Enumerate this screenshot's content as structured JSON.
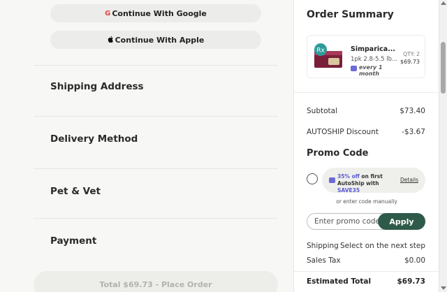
{
  "social": {
    "google_label": "Continue With Google",
    "google_icon": "G",
    "apple_label": "Continue With Apple",
    "apple_icon": "apple-icon"
  },
  "sections": {
    "shipping": "Shipping Address",
    "delivery": "Delivery Method",
    "pet_vet": "Pet & Vet",
    "payment": "Payment"
  },
  "place_order": "Total $69.73 - Place Order",
  "summary": {
    "title": "Order Summary",
    "product": {
      "name": "Simparica...",
      "variant": "1pk 2.8-5.5 lb...",
      "autoship": "every 1 month",
      "qty": "QTY: 2",
      "price": "$69.73"
    },
    "subtotal_label": "Subtotal",
    "subtotal_value": "$73.40",
    "discount_label": "AUTOSHIP Discount",
    "discount_value": "-$3.67",
    "promo_title": "Promo Code",
    "promo": {
      "percent": "35% off",
      "text_a": " on first AutoShip with ",
      "code": "SAVE35",
      "details": "Details"
    },
    "manual_text": "or enter code manually",
    "input_placeholder": "Enter promo code",
    "apply_label": "Apply",
    "shipping_label": "Shipping",
    "shipping_value": "Select on the next step",
    "tax_label": "Sales Tax",
    "tax_value": "$0.00",
    "total_label": "Estimated Total",
    "total_value": "$69.73"
  },
  "colors": {
    "accent": "#2f5a4a",
    "promo_highlight": "#5b5bd0"
  }
}
